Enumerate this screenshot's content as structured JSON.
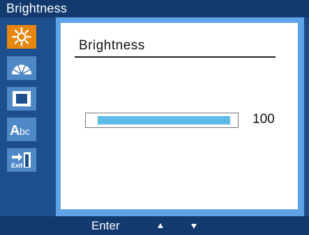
{
  "title_bar": {
    "label": "Brightness"
  },
  "menu": {
    "items": [
      {
        "icon": "brightness-icon",
        "active": true
      },
      {
        "icon": "color-icon",
        "active": false
      },
      {
        "icon": "image-icon",
        "active": false
      },
      {
        "icon": "language-icon",
        "label": "Abc",
        "active": false
      },
      {
        "icon": "exit-icon",
        "label": "Exit",
        "active": false
      }
    ]
  },
  "panel": {
    "title": "Brightness",
    "slider": {
      "value": "100",
      "fraction": 1.0
    }
  },
  "bottom_bar": {
    "enter_label": "Enter",
    "up_icon": "arrow-up-icon",
    "down_icon": "arrow-down-icon"
  },
  "colors": {
    "title_bar": "#123a6e",
    "sidebar": "#1d4e8e",
    "active_icon": "#e8870e",
    "icon_tile": "#4f88c7",
    "content_frame": "#5fa3e6",
    "slider_fill": "#5dbbe8"
  }
}
